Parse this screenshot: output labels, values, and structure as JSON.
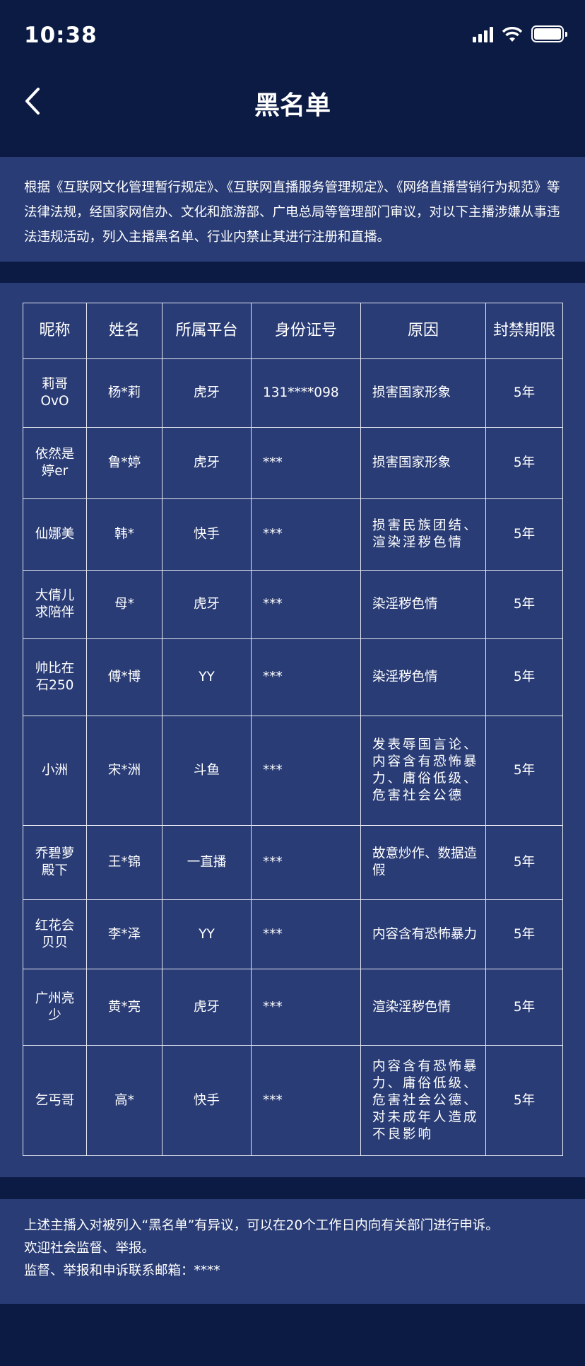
{
  "status_bar": {
    "time": "10:38",
    "icons": [
      "signal-icon",
      "wifi-icon",
      "battery-icon"
    ]
  },
  "nav": {
    "title": "黑名单",
    "back_icon": "chevron-left-icon"
  },
  "intro": "根据《互联网文化管理暂行规定》、《互联网直播服务管理规定》、《网络直播营销行为规范》等法律法规，经国家网信办、文化和旅游部、广电总局等管理部门审议，对以下主播涉嫌从事违法违规活动，列入主播黑名单、行业内禁止其进行注册和直播。",
  "table": {
    "headers": [
      "昵称",
      "姓名",
      "所属平台",
      "身份证号",
      "原因",
      "封禁期限"
    ],
    "rows": [
      [
        "莉哥OvO",
        "杨*莉",
        "虎牙",
        "131****098",
        "损害国家形象",
        "5年"
      ],
      [
        "依然是婷er",
        "鲁*婷",
        "虎牙",
        "***",
        "损害国家形象",
        "5年"
      ],
      [
        "仙娜美",
        "韩*",
        "快手",
        "***",
        "损害民族团结、渲染淫秽色情",
        "5年"
      ],
      [
        "大倩儿求陪伴",
        "母*",
        "虎牙",
        "***",
        "染淫秽色情",
        "5年"
      ],
      [
        "帅比在石250",
        "傅*博",
        "YY",
        "***",
        "染淫秽色情",
        "5年"
      ],
      [
        "小洲",
        "宋*洲",
        "斗鱼",
        "***",
        "发表辱国言论、内容含有恐怖暴力、庸俗低级、危害社会公德",
        "5年"
      ],
      [
        "乔碧萝殿下",
        "王*锦",
        "一直播",
        "***",
        "故意炒作、数据造假",
        "5年"
      ],
      [
        "红花会贝贝",
        "李*泽",
        "YY",
        "***",
        "内容含有恐怖暴力",
        "5年"
      ],
      [
        "广州亮少",
        "黄*亮",
        "虎牙",
        "***",
        "渲染淫秽色情",
        "5年"
      ],
      [
        "乞丐哥",
        "高*",
        "快手",
        "***",
        "内容含有恐怖暴力、庸俗低级、危害社会公德、对未成年人造成不良影响",
        "5年"
      ]
    ]
  },
  "footer": {
    "lines": [
      "上述主播入对被列入“黑名单”有异议，可以在20个工作日内向有关部门进行申诉。",
      "欢迎社会监督、举报。",
      "监督、举报和申诉联系邮箱：****"
    ]
  },
  "colors": {
    "background": "#0b1b44",
    "panel": "#293c75",
    "border": "#e6e9f2",
    "text": "#ffffff"
  }
}
